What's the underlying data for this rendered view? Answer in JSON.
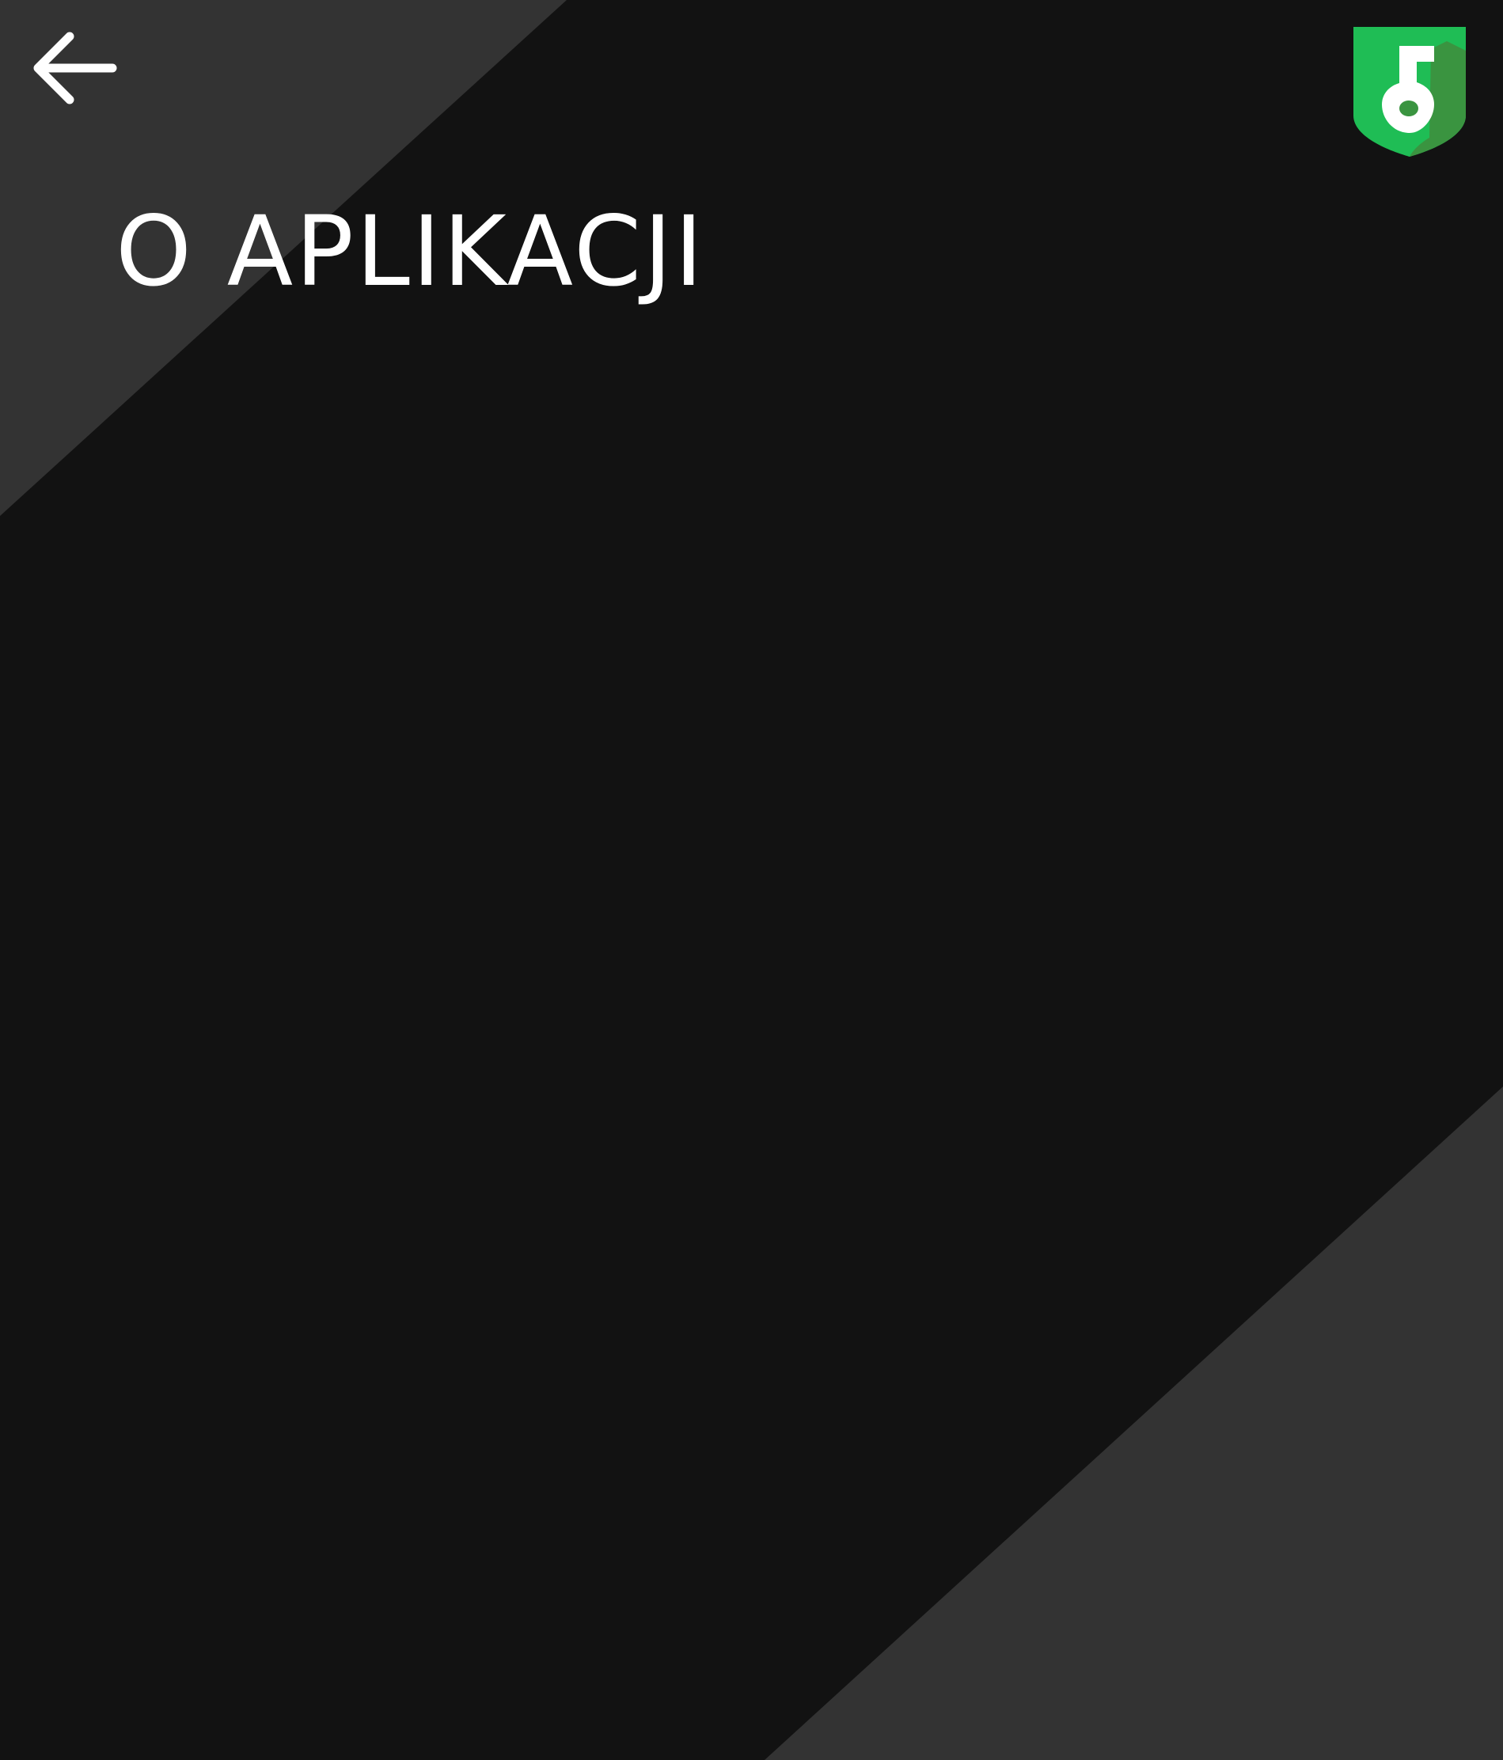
{
  "header": {
    "back_icon": "arrow-left-icon",
    "logo_icon": "shield-key-icon",
    "title": "O APLIKACJI"
  },
  "colors": {
    "background": "#121212",
    "accent_band": "#333333",
    "brand_green": "#1fbd55",
    "brand_green_dark": "#3a9440",
    "text": "#ffffff"
  }
}
